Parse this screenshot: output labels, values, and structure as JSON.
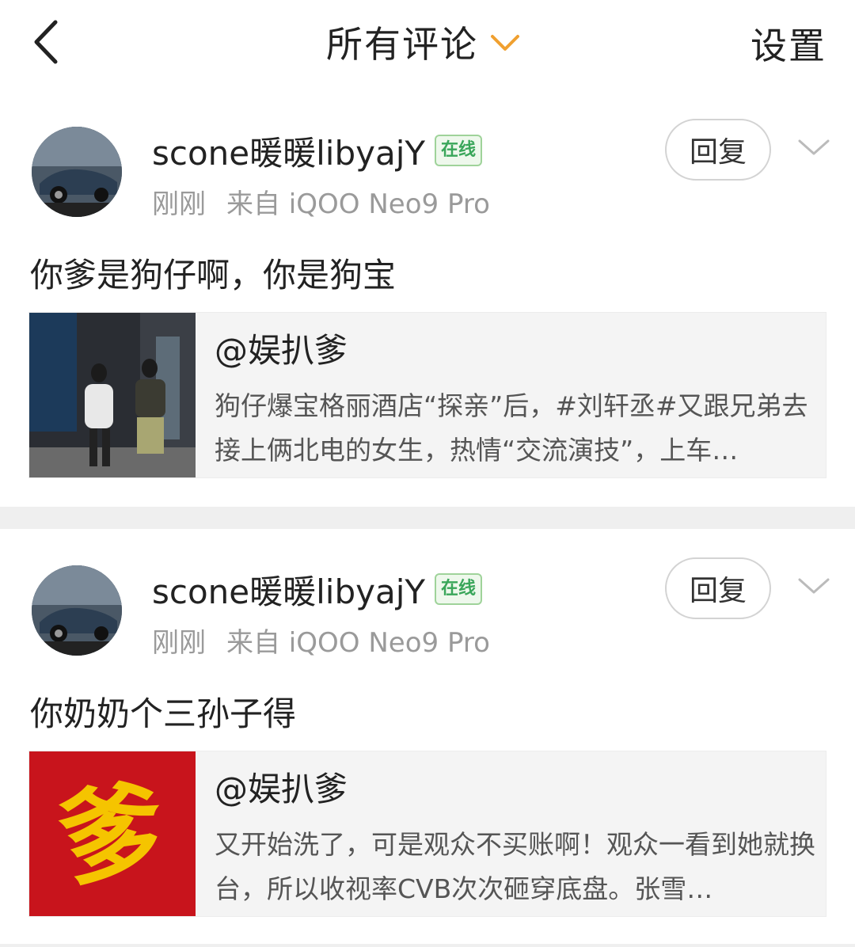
{
  "header": {
    "back_icon": "back-arrow-icon",
    "title": "所有评论",
    "dropdown_icon": "chevron-down-icon",
    "dropdown_color": "#f0a030",
    "settings_label": "设置"
  },
  "comments": [
    {
      "username": "scone暖暖libyajY",
      "badge": "在线",
      "time": "刚刚",
      "source": "来自 iQOO Neo9 Pro",
      "reply_label": "回复",
      "text": "你爹是狗仔啊，你是狗宝",
      "card": {
        "title": "@娱扒爹",
        "body": "狗仔爆宝格丽酒店“探亲”后，#刘轩丞#又跟兄弟去接上俩北电的女生，热情“交流演技”，上车…"
      }
    },
    {
      "username": "scone暖暖libyajY",
      "badge": "在线",
      "time": "刚刚",
      "source": "来自 iQOO Neo9 Pro",
      "reply_label": "回复",
      "text": "你奶奶个三孙子得",
      "card": {
        "title": "@娱扒爹",
        "body": "又开始洗了，可是观众不买账啊！观众一看到她就换台，所以收视率CVB次次砸穿底盘。张雪…",
        "thumb_glyph": "爹"
      }
    }
  ],
  "colors": {
    "online_green": "#3aa65a",
    "thumb_red": "#c8141c",
    "thumb_glyph": "#f5c400"
  }
}
